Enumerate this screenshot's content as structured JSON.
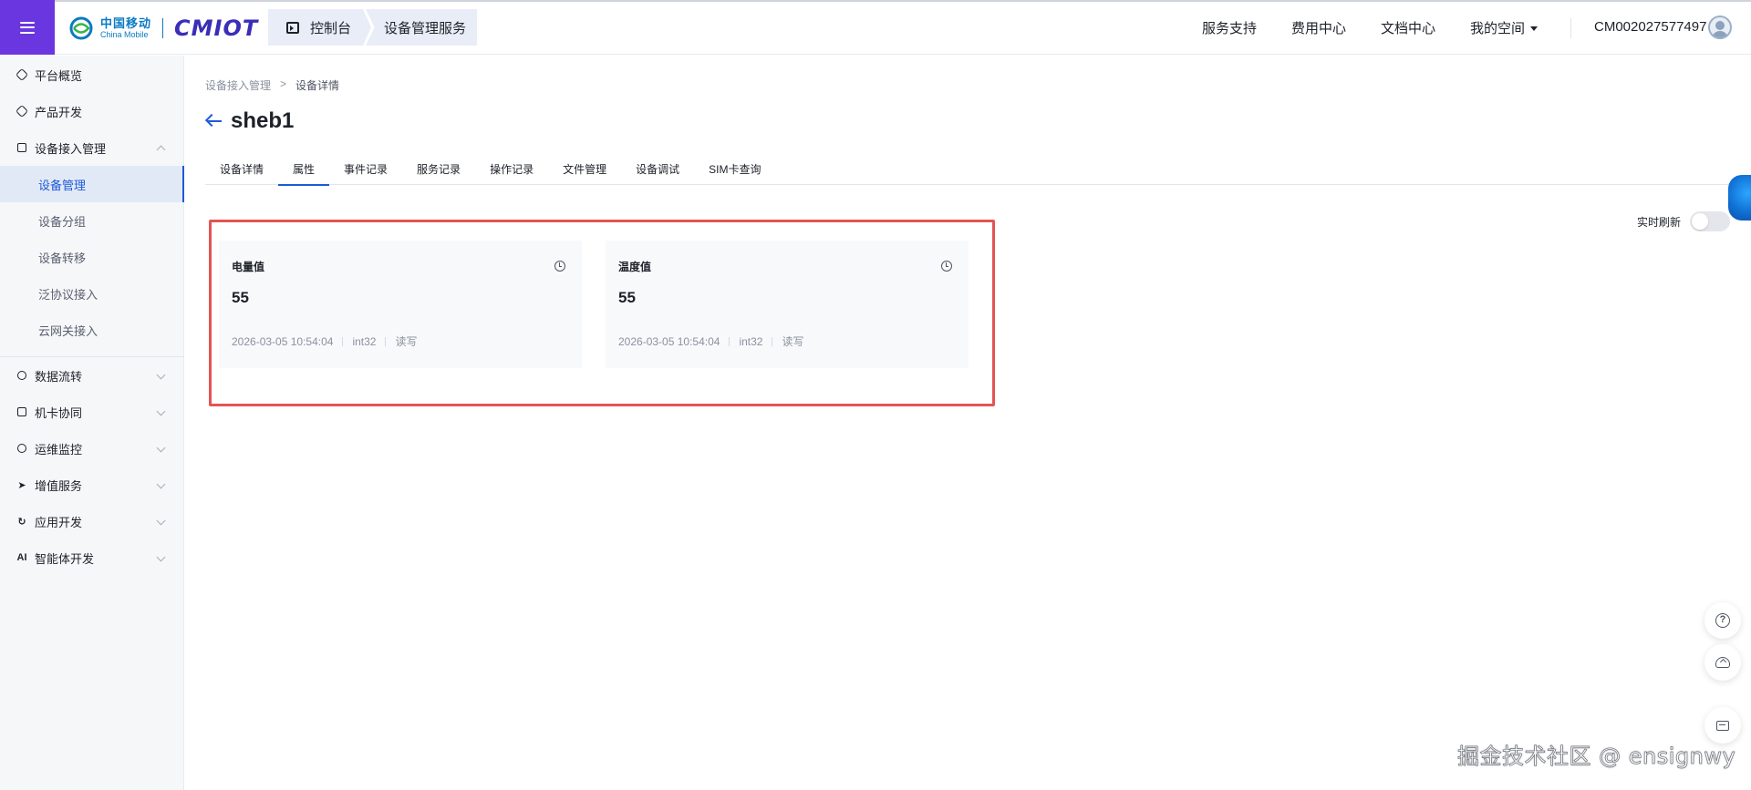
{
  "header": {
    "logo_cn": "中国移动",
    "logo_en": "China Mobile",
    "logo_product": "CMIOT",
    "console_tab": "控制台",
    "service_tab": "设备管理服务",
    "links": [
      "服务支持",
      "费用中心",
      "文档中心",
      "我的空间"
    ],
    "account": "CM002027577497"
  },
  "sidebar": {
    "items": [
      {
        "label": "平台概览",
        "icon": "hexagon-icon"
      },
      {
        "label": "产品开发",
        "icon": "cube-icon"
      },
      {
        "label": "设备接入管理",
        "icon": "devices-icon"
      },
      {
        "label": "数据流转",
        "icon": "flow-icon"
      },
      {
        "label": "机卡协同",
        "icon": "link-icon"
      },
      {
        "label": "运维监控",
        "icon": "chart-pie-icon"
      },
      {
        "label": "增值服务",
        "icon": "send-icon"
      },
      {
        "label": "应用开发",
        "icon": "app-icon"
      },
      {
        "label": "智能体开发",
        "icon": "ai-icon",
        "icon_text": "AI"
      }
    ],
    "sub_items": [
      "设备管理",
      "设备分组",
      "设备转移",
      "泛协议接入",
      "云网关接入"
    ]
  },
  "breadcrumb": {
    "parent": "设备接入管理",
    "separator": ">",
    "current": "设备详情"
  },
  "page": {
    "title": "sheb1"
  },
  "tabs": [
    "设备详情",
    "属性",
    "事件记录",
    "服务记录",
    "操作记录",
    "文件管理",
    "设备调试",
    "SIM卡查询"
  ],
  "active_tab": "属性",
  "realtime": {
    "label": "实时刷新",
    "enabled": false
  },
  "properties": [
    {
      "name": "电量值",
      "value": "55",
      "time": "2026-03-05 10:54:04",
      "type": "int32",
      "access": "读写"
    },
    {
      "name": "温度值",
      "value": "55",
      "time": "2026-03-05 10:54:04",
      "type": "int32",
      "access": "读写"
    }
  ],
  "watermark": "掘金技术社区 @ ensignwy",
  "colors": {
    "brand_purple": "#6a36e0",
    "accent_blue": "#1e5ad7",
    "highlight_red": "#e35454"
  }
}
